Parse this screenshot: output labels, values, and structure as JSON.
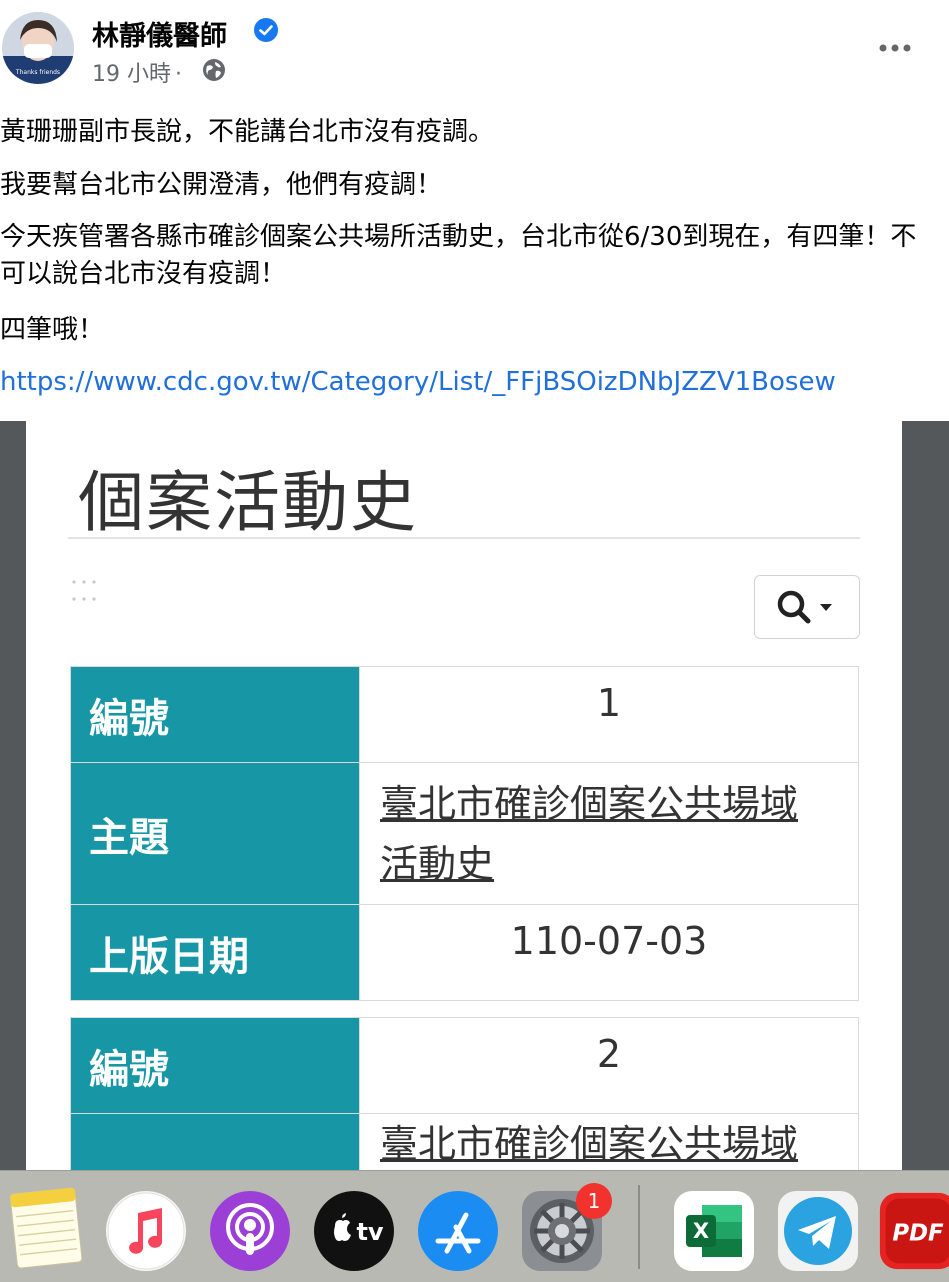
{
  "post": {
    "author": "林靜儀醫師",
    "time": "19 小時",
    "separator": "·",
    "paragraphs": [
      "黃珊珊副市長說，不能講台北市沒有疫調。",
      "我要幫台北市公開澄清，他們有疫調！",
      "今天疾管署各縣市確診個案公共場所活動史，台北市從6/30到現在，有四筆！不可以說台北市沒有疫調！",
      "四筆哦！"
    ],
    "link": "https://www.cdc.gov.tw/Category/List/_FFjBSOizDNbJZZV1Bosew",
    "avatar_caption": "Thanks friends"
  },
  "screenshot": {
    "page_title": "個案活動史",
    "records": [
      {
        "no_label": "編號",
        "no_value": "1",
        "topic_label": "主題",
        "topic_line1": "臺北市確診個案公共場域",
        "topic_line2": "活動史",
        "date_label": "上版日期",
        "date_value": "110-07-03"
      },
      {
        "no_label": "編號",
        "no_value": "2",
        "topic_line1": "臺北市確診個案公共場域"
      }
    ]
  },
  "dock": {
    "badge_count": "1",
    "apps": [
      "notes-icon",
      "music-icon",
      "podcasts-icon",
      "apple-tv-icon",
      "app-store-icon",
      "system-preferences-icon",
      "excel-icon",
      "telegram-icon",
      "pdf-icon"
    ],
    "tv_label": "tv",
    "excel_letter": "X",
    "pdf_label": "PDF"
  },
  "colors": {
    "accent_blue": "#216fdb",
    "table_header": "#1796a6",
    "verified": "#1877f2"
  }
}
